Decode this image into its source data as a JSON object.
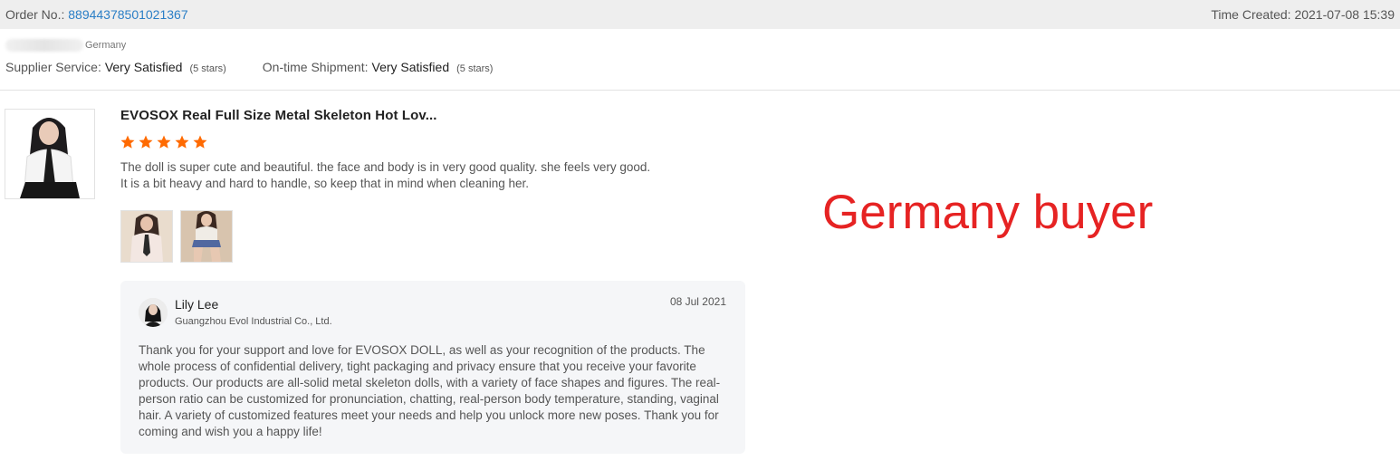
{
  "header": {
    "order_label": "Order No.:",
    "order_number": "88944378501021367",
    "time_label": "Time Created:",
    "time_value": "2021-07-08 15:39"
  },
  "buyer": {
    "country": "Germany"
  },
  "ratings": {
    "supplier_label": "Supplier Service:",
    "supplier_value": "Very Satisfied",
    "supplier_stars": "(5 stars)",
    "shipment_label": "On-time Shipment:",
    "shipment_value": "Very Satisfied",
    "shipment_stars": "(5 stars)"
  },
  "product": {
    "title": "EVOSOX Real Full Size Metal Skeleton Hot Lov...",
    "rating": 5,
    "review_line1": "The doll is super cute and beautiful. the face and body is in very good quality. she feels very good.",
    "review_line2": "It is a bit heavy and hard to handle, so keep that in mind when cleaning her."
  },
  "reply": {
    "name": "Lily Lee",
    "company": "Guangzhou Evol Industrial Co., Ltd.",
    "date": "08 Jul 2021",
    "text": "Thank you for your support and love for EVOSOX DOLL, as well as your recognition of the products. The whole process of confidential delivery, tight packaging and privacy ensure that you receive your favorite products. Our products are all-solid metal skeleton dolls, with a variety of face shapes and figures. The real-person ratio can be customized for pronunciation, chatting, real-person body temperature, standing, vaginal hair. A variety of customized features meet your needs and help you unlock more new poses. Thank you for coming and wish you a happy life!"
  },
  "annotation": {
    "text": "Germany buyer",
    "color": "#e62323"
  },
  "colors": {
    "link": "#2a7ec6",
    "star": "#ff6a00",
    "header_bg": "#eeeeee",
    "reply_bg": "#f5f6f8"
  }
}
